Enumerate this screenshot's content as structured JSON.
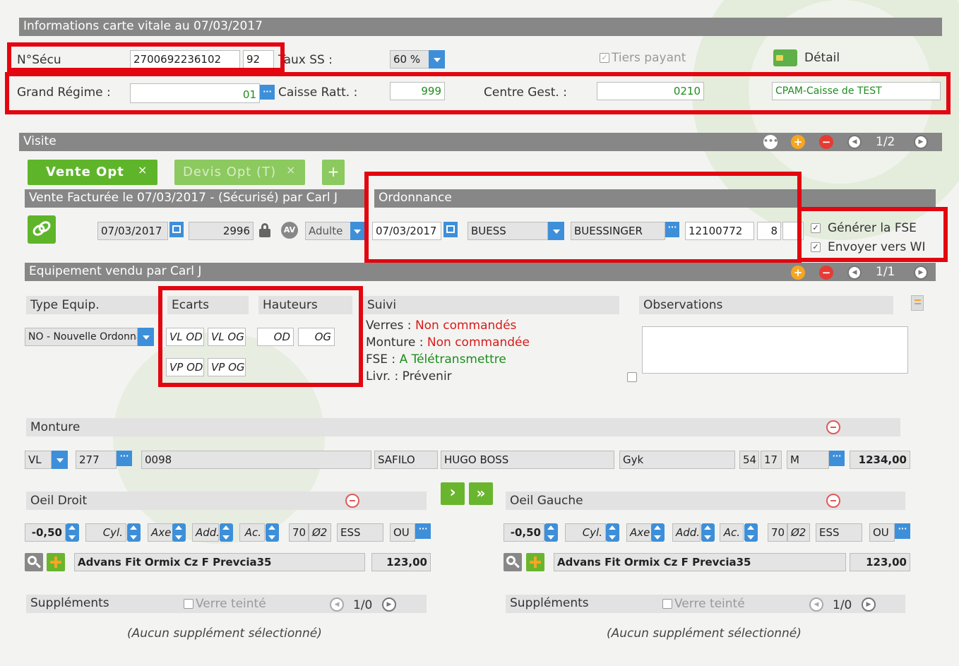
{
  "carte": {
    "title": "Informations carte vitale au 07/03/2017",
    "nsecu_label": "N°Sécu",
    "nsecu_value": "2700692236102",
    "nsecu_key": "92",
    "taux_label": "Taux SS :",
    "taux_value": "60 %",
    "tiers_label": "Tiers payant",
    "detail_label": "Détail",
    "regime_label": "Grand Régime :",
    "regime_value": "01",
    "caisse_label": "Caisse Ratt. :",
    "caisse_value": "999",
    "centre_label": "Centre Gest. :",
    "centre_value": "0210",
    "cpam_value": "CPAM-Caisse de TEST"
  },
  "visite": {
    "title": "Visite",
    "pager": "1/2",
    "tabs": [
      {
        "label": "Vente Opt"
      },
      {
        "label": "Devis Opt (T)"
      }
    ],
    "close": "×",
    "add": "+"
  },
  "vente": {
    "title": "Vente Facturée le 07/03/2017 - (Sécurisé) par Carl J",
    "date": "07/03/2017",
    "number": "2996",
    "av": "AV",
    "client_type": "Adulte"
  },
  "ordonnance": {
    "title": "Ordonnance",
    "date": "07/03/2017",
    "code": "BUESS",
    "name": "BUESSINGER",
    "rpps": "12100772",
    "key": "8",
    "fse_label": "Générer la FSE",
    "wi_label": "Envoyer vers WI"
  },
  "equipement": {
    "title": "Equipement vendu par Carl J",
    "pager": "1/1",
    "type_header": "Type Equip.",
    "type_value": "NO - Nouvelle Ordonnance",
    "ecarts_header": "Ecarts",
    "hauteurs_header": "Hauteurs",
    "vl_od": "VL OD",
    "vl_og": "VL OG",
    "vp_od": "VP OD",
    "vp_og": "VP OG",
    "h_od": "OD",
    "h_og": "OG",
    "suivi_header": "Suivi",
    "suivi": [
      {
        "label": "Verres :",
        "value": "Non commandés",
        "color": "#d81b1b"
      },
      {
        "label": "Monture :",
        "value": "Non commandée",
        "color": "#d81b1b"
      },
      {
        "label": "FSE :",
        "value": "A Télétransmettre",
        "color": "#1e8c1e"
      },
      {
        "label": "Livr. :",
        "value": "Prévenir",
        "color": "#333333"
      }
    ],
    "obs_header": "Observations"
  },
  "monture": {
    "title": "Monture",
    "type": "VL",
    "code": "277",
    "ref": "0098",
    "supplier": "SAFILO",
    "brand": "HUGO BOSS",
    "color": "Gyk",
    "size_a": "54",
    "size_b": "17",
    "size_c": "M",
    "price": "1234,00"
  },
  "oeil_droit": {
    "title": "Oeil Droit",
    "sph": "-0,50",
    "cyl": "Cyl.",
    "axe": "Axe",
    "add": "Add.",
    "ac": "Ac.",
    "diam": "70",
    "phi": "Ø2",
    "ess": "ESS",
    "ou": "OU",
    "lens": "Advans Fit Ormix Cz F Prevcia35",
    "price": "123,00",
    "supp_title": "Suppléments",
    "supp_option": "Verre teinté",
    "supp_pager": "1/0",
    "supp_empty": "(Aucun supplément sélectionné)"
  },
  "oeil_gauche": {
    "title": "Oeil Gauche",
    "sph": "-0,50",
    "cyl": "Cyl.",
    "axe": "Axe",
    "add": "Add.",
    "ac": "Ac.",
    "diam": "70",
    "phi": "Ø2",
    "ess": "ESS",
    "ou": "OU",
    "lens": "Advans Fit Ormix Cz F Prevcia35",
    "price": "123,00",
    "supp_title": "Suppléments",
    "supp_option": "Verre teinté",
    "supp_pager": "1/0",
    "supp_empty": "(Aucun supplément sélectionné)"
  },
  "colors": {
    "accent": "#3e8fd9",
    "green": "#6ab52e",
    "highlight": "#e3050f",
    "bar": "#878787"
  }
}
